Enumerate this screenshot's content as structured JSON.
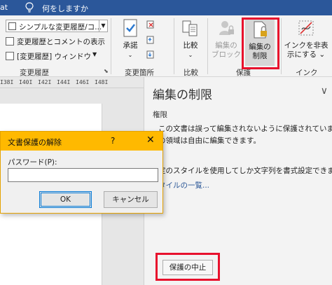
{
  "titlebar": {
    "app_fragment": "at",
    "tell_me": "何をしますか"
  },
  "ribbon": {
    "tracking": {
      "markup_select_value": "シンプルな変更履歴/コ...",
      "show_markup": "変更履歴とコメントの表示",
      "pane_label": "[変更履歴] ウィンドウ",
      "group_label": "変更履歴"
    },
    "changes": {
      "accept": "承諾",
      "group_label": "変更箇所"
    },
    "compare": {
      "compare": "比較",
      "group_label": "比較"
    },
    "protect": {
      "block_authors_line1": "編集の",
      "block_authors_line2": "ブロック",
      "restrict_line1": "編集の",
      "restrict_line2": "制限",
      "group_label": "保護"
    },
    "ink": {
      "hide_ink_line1": "インクを非表",
      "hide_ink_line2": "示にする",
      "dropdown_glyph": "⌄",
      "group_label": "インク"
    }
  },
  "ruler": {
    "ticks": [
      "I38I",
      "I40I",
      "I42I",
      "I44I",
      "I46I",
      "I48I"
    ]
  },
  "pane": {
    "title": "編集の制限",
    "chevron": "∨",
    "section": "権限",
    "line1": "この文書は誤って編集されないように保護されています。",
    "line2": "の領域は自由に編集できます。",
    "line3": "定のスタイルを使用してしか文字列を書式設定できませ",
    "link": "タイルの一覧...",
    "stop_button": "保護の中止"
  },
  "dialog": {
    "title": "文書保護の解除",
    "help": "?",
    "close": "✕",
    "password_label": "パスワード(P):",
    "password_value": "",
    "ok": "OK",
    "cancel": "キャンセル"
  },
  "colors": {
    "titlebar": "#2b579a",
    "dialog_titlebar": "#ffb900",
    "highlight": "#e8112d",
    "link": "#2b5797"
  }
}
